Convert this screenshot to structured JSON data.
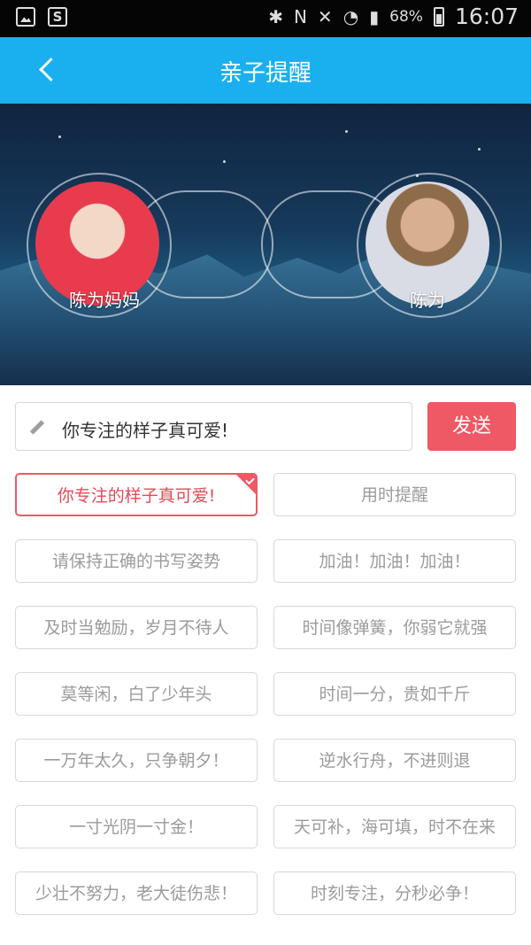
{
  "statusbar": {
    "battery_percent": "68%",
    "time": "16:07"
  },
  "header": {
    "title": "亲子提醒"
  },
  "parent": {
    "name": "陈为妈妈"
  },
  "child": {
    "name": "陈为"
  },
  "composer": {
    "input_value": "你专注的样子真可爱!",
    "send_label": "发送"
  },
  "phrases": [
    {
      "label": "你专注的样子真可爱!",
      "selected": true
    },
    {
      "label": "用时提醒",
      "selected": false
    },
    {
      "label": "请保持正确的书写姿势",
      "selected": false
    },
    {
      "label": "加油！加油！加油！",
      "selected": false
    },
    {
      "label": "及时当勉励，岁月不待人",
      "selected": false
    },
    {
      "label": "时间像弹簧，你弱它就强",
      "selected": false
    },
    {
      "label": "莫等闲，白了少年头",
      "selected": false
    },
    {
      "label": "时间一分，贵如千斤",
      "selected": false
    },
    {
      "label": "一万年太久，只争朝夕！",
      "selected": false
    },
    {
      "label": "逆水行舟，不进则退",
      "selected": false
    },
    {
      "label": "一寸光阴一寸金！",
      "selected": false
    },
    {
      "label": "天可补，海可填，时不在来",
      "selected": false
    },
    {
      "label": "少壮不努力，老大徒伤悲！",
      "selected": false
    },
    {
      "label": "时刻专注，分秒必争！",
      "selected": false
    }
  ],
  "colors": {
    "appbar": "#1ab0f0",
    "accent": "#ef5865"
  }
}
